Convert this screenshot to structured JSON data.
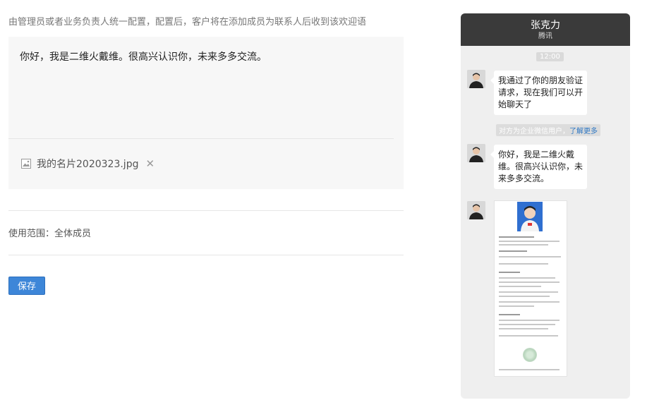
{
  "description": "由管理员或者业务负责人统一配置，配置后，客户将在添加成员为联系人后收到该欢迎语",
  "editor": {
    "message": "你好，我是二维火戴维。很高兴认识你，未来多多交流。",
    "attachment": {
      "filename": "我的名片2020323.jpg",
      "icon": "image-icon",
      "remove_symbol": "✕"
    }
  },
  "scope": "使用范围：全体成员",
  "save_label": "保存",
  "colors": {
    "primary_button": "#3d86d8",
    "phone_header": "#3a3a3a",
    "chat_background": "#efefef",
    "link": "#2f78c4"
  },
  "preview": {
    "contact_name": "张克力",
    "contact_org": "腾讯",
    "time": "12:00",
    "first_message": "我通过了你的朋友验证请求，现在我们可以开始聊天了",
    "system_notice": "对方为企业微信用户，",
    "system_link": "了解更多",
    "welcome_message": "你好，我是二维火戴维。很高兴认识你，未来多多交流。"
  }
}
